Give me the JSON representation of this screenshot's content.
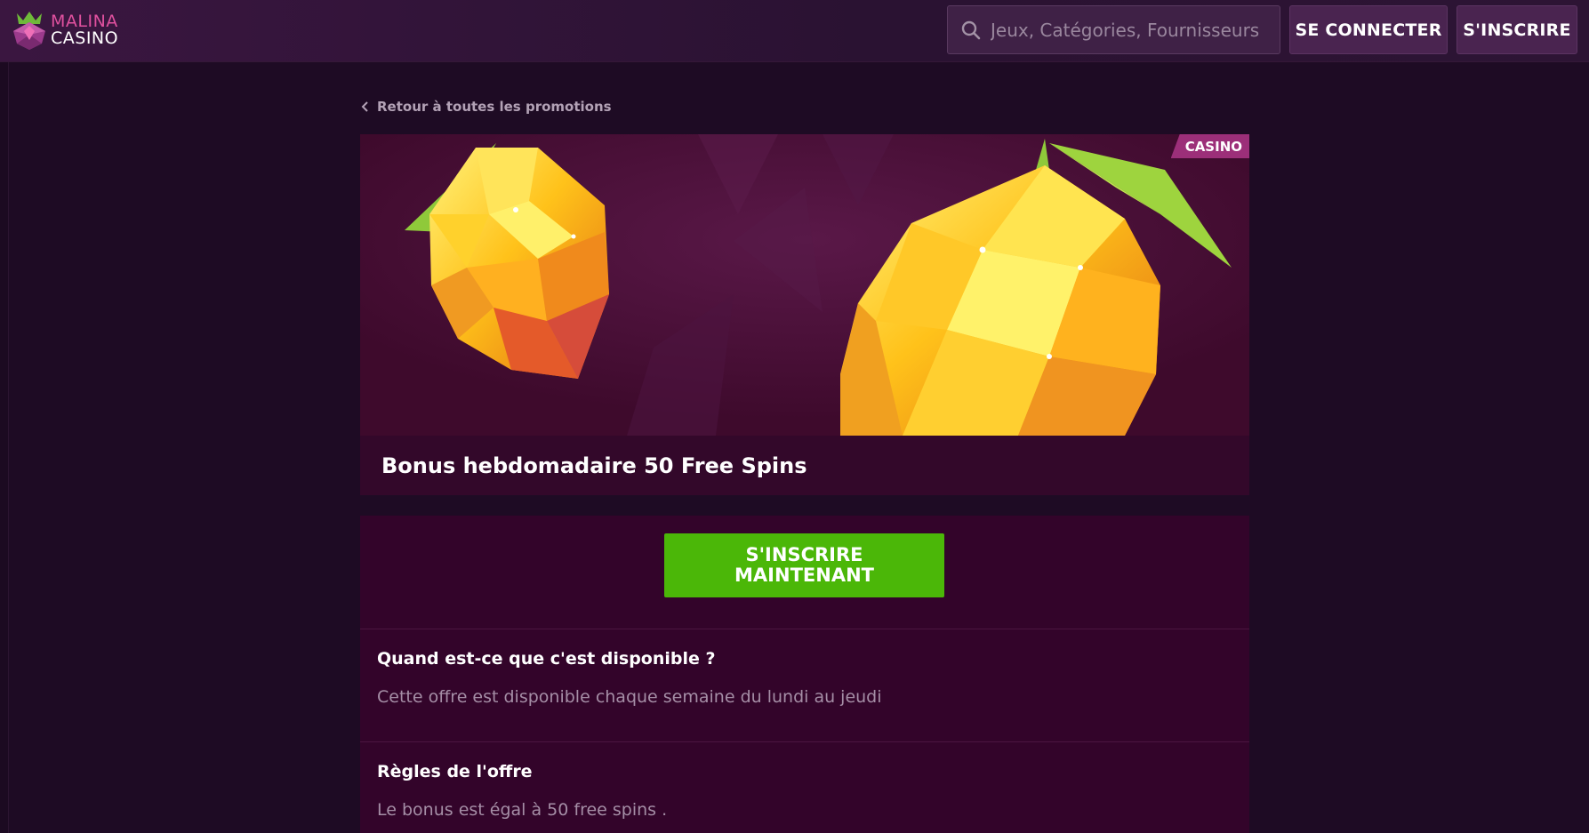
{
  "header": {
    "logo_line1": "MALINA",
    "logo_line2": "CASINO",
    "search_placeholder": "Jeux, Catégories, Fournisseurs",
    "login_label": "SE CONNECTER",
    "register_label": "S'INSCRIRE"
  },
  "back_link": "Retour à toutes les promotions",
  "promo": {
    "tag": "CASINO",
    "title": "Bonus hebdomadaire 50 Free Spins",
    "cta_label": "S'INSCRIRE MAINTENANT",
    "sections": [
      {
        "heading": "Quand est-ce que c'est disponible ?",
        "text": "Cette offre est disponible chaque semaine du lundi au jeudi"
      },
      {
        "heading": "Règles de l'offre",
        "text": "Le bonus est égal à 50 free spins ."
      }
    ]
  },
  "colors": {
    "brand_pink": "#e0519f",
    "cta_green": "#4bb708",
    "tag_magenta": "#9c2f79",
    "background": "#1e0b24"
  },
  "icons": [
    "malina-logo-icon",
    "search-icon",
    "chevron-left-icon"
  ]
}
